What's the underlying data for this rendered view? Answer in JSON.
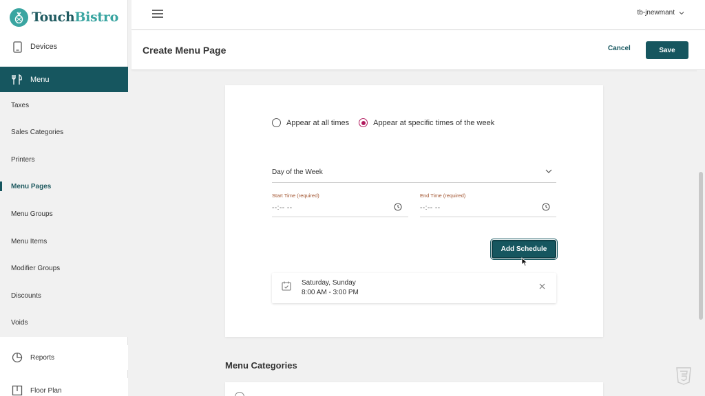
{
  "brand": {
    "name_part1": "Touch",
    "name_part2": "Bistro"
  },
  "sidebar": {
    "devices_label": "Devices",
    "menu_label": "Menu",
    "subitems": [
      {
        "label": "Taxes",
        "active": false
      },
      {
        "label": "Sales Categories",
        "active": false
      },
      {
        "label": "Printers",
        "active": false
      },
      {
        "label": "Menu Pages",
        "active": true
      },
      {
        "label": "Menu Groups",
        "active": false
      },
      {
        "label": "Menu Items",
        "active": false
      },
      {
        "label": "Modifier Groups",
        "active": false
      },
      {
        "label": "Discounts",
        "active": false
      },
      {
        "label": "Voids",
        "active": false
      }
    ],
    "reports_label": "Reports",
    "floorplan_label": "Floor Plan"
  },
  "topbar": {
    "username": "tb-jnewmant"
  },
  "header": {
    "title": "Create Menu Page",
    "cancel_label": "Cancel",
    "save_label": "Save"
  },
  "visibility": {
    "option_all": "Appear at all times",
    "option_specific": "Appear at specific times of the week",
    "selected": "specific"
  },
  "schedule_form": {
    "day_select": "Day of the Week",
    "start_label": "Start Time (required)",
    "start_value": "--:-- --",
    "end_label": "End Time (required)",
    "end_value": "--:-- --",
    "add_label": "Add Schedule"
  },
  "schedules": [
    {
      "days": "Saturday, Sunday",
      "time": "8:00 AM - 3:00 PM"
    }
  ],
  "menu_categories": {
    "title": "Menu Categories"
  },
  "colors": {
    "primary": "#16565f",
    "accent": "#3aa5a1",
    "radio": "#b21a5e"
  }
}
